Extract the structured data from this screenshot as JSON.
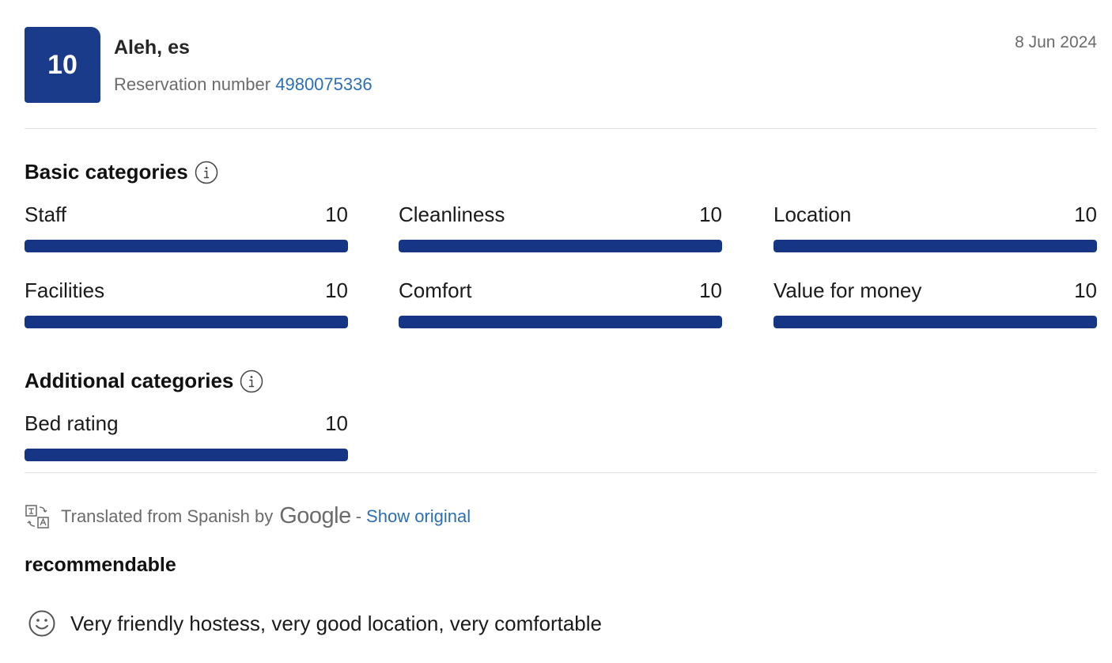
{
  "review": {
    "score": "10",
    "reviewer": "Aleh, es",
    "reservation_label": "Reservation number",
    "reservation_number": "4980075336",
    "date": "8 Jun 2024"
  },
  "basic": {
    "title": "Basic categories",
    "items": [
      {
        "label": "Staff",
        "value": "10",
        "fraction": 1.0
      },
      {
        "label": "Cleanliness",
        "value": "10",
        "fraction": 1.0
      },
      {
        "label": "Location",
        "value": "10",
        "fraction": 1.0
      },
      {
        "label": "Facilities",
        "value": "10",
        "fraction": 1.0
      },
      {
        "label": "Comfort",
        "value": "10",
        "fraction": 1.0
      },
      {
        "label": "Value for money",
        "value": "10",
        "fraction": 1.0
      }
    ]
  },
  "additional": {
    "title": "Additional categories",
    "items": [
      {
        "label": "Bed rating",
        "value": "10",
        "fraction": 1.0
      }
    ]
  },
  "translation": {
    "text": "Translated from Spanish by",
    "brand": "Google",
    "separator": "-",
    "show_original": "Show original"
  },
  "content": {
    "title": "recommendable",
    "positive": "Very friendly hostess, very good location, very comfortable"
  },
  "colors": {
    "badge": "#1a3a8a",
    "bar": "#163685",
    "link": "#2c6fb8"
  },
  "icons": [
    "info-icon",
    "translate-icon",
    "smiley-icon"
  ]
}
